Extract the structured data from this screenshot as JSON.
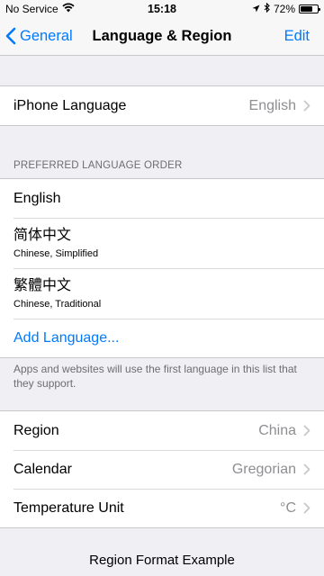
{
  "status_bar": {
    "carrier": "No Service",
    "time": "15:18",
    "battery": "72%",
    "battery_level": 0.72
  },
  "nav": {
    "back_label": "General",
    "title": "Language & Region",
    "edit_label": "Edit"
  },
  "iphone_language": {
    "label": "iPhone Language",
    "value": "English"
  },
  "preferred": {
    "header": "PREFERRED LANGUAGE ORDER",
    "languages": [
      {
        "title": "English",
        "subtitle": ""
      },
      {
        "title": "简体中文",
        "subtitle": "Chinese, Simplified"
      },
      {
        "title": "繁體中文",
        "subtitle": "Chinese, Traditional"
      }
    ],
    "add_label": "Add Language...",
    "footer": "Apps and websites will use the first language in this list that they support."
  },
  "region_settings": [
    {
      "label": "Region",
      "value": "China"
    },
    {
      "label": "Calendar",
      "value": "Gregorian"
    },
    {
      "label": "Temperature Unit",
      "value": "°C"
    }
  ],
  "format_example": {
    "title": "Region Format Example"
  },
  "colors": {
    "accent": "#007aff",
    "background": "#efeff4",
    "secondary_text": "#8e8e93"
  }
}
